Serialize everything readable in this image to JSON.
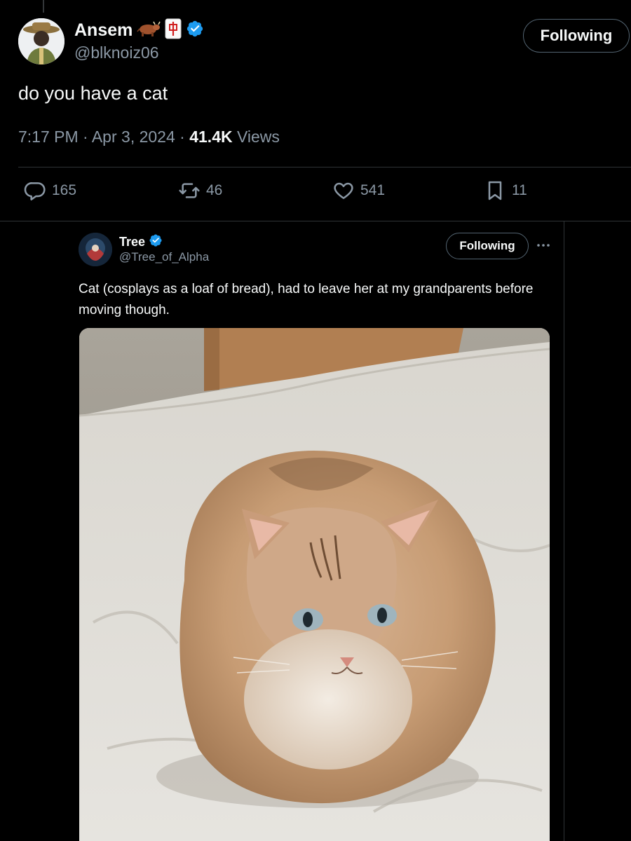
{
  "tweet": {
    "author": {
      "name": "Ansem",
      "emoji_1": "🐂",
      "emoji_2": "🀄",
      "handle": "@blknoiz06",
      "verified": true
    },
    "follow_button": "Following",
    "text": "do you have a cat",
    "time": "7:17 PM",
    "separator": "·",
    "date": "Apr 3, 2024",
    "views_count": "41.4K",
    "views_label": "Views",
    "stats": {
      "replies": "165",
      "retweets": "46",
      "likes": "541",
      "bookmarks": "11"
    }
  },
  "reply": {
    "author": {
      "name": "Tree",
      "handle": "@Tree_of_Alpha",
      "verified": true
    },
    "follow_button": "Following",
    "text": "Cat (cosplays as a loaf of bread), had to leave her at my grandparents before moving though.",
    "image": {
      "subject": "tabby cat loafing on a white bedsheet"
    }
  },
  "colors": {
    "background": "#000000",
    "text_primary": "#f7f9f9",
    "text_secondary": "#8b98a5",
    "divider": "#2f3336",
    "verified_blue": "#1d9bf0"
  },
  "icons": [
    "ox-emoji",
    "mahjong-emoji",
    "verified-badge-icon",
    "reply-icon",
    "retweet-icon",
    "like-icon",
    "bookmark-icon",
    "more-icon"
  ]
}
